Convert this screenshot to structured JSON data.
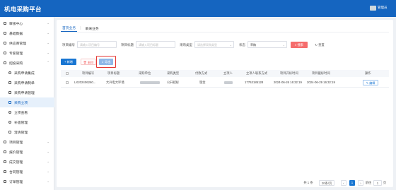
{
  "header": {
    "title": "机电采购平台",
    "user": "管理员"
  },
  "sidebar": {
    "items": [
      {
        "label": "审核中心"
      },
      {
        "label": "基础数据"
      },
      {
        "label": "供应商管理"
      },
      {
        "label": "专家管理"
      },
      {
        "label": "招投采购"
      },
      {
        "label": "采购申请集成"
      },
      {
        "label": "采购申请制单"
      },
      {
        "label": "采购申请管理"
      },
      {
        "label": "采购立项"
      },
      {
        "label": "立项查看"
      },
      {
        "label": "补遗管理"
      },
      {
        "label": "澄清管理"
      },
      {
        "label": "项目管理"
      },
      {
        "label": "报价管理"
      },
      {
        "label": "成交管理"
      },
      {
        "label": "合同管理"
      },
      {
        "label": "订单管理"
      }
    ]
  },
  "tabs": [
    {
      "label": "首页业务"
    },
    {
      "label": "单采业务"
    }
  ],
  "filters": {
    "project_no": {
      "label": "项目编号",
      "placeholder": "请输入项目编号"
    },
    "project_title": {
      "label": "项目标题",
      "placeholder": "请输入项目标题"
    },
    "purchase_type": {
      "label": "采购类型",
      "placeholder": "请选择采购类型"
    },
    "status": {
      "label": "状态",
      "value": "草稿"
    },
    "search_label": "搜索",
    "reset_label": "重置"
  },
  "toolbar": {
    "add_label": "新增",
    "delete_label": "删除",
    "export_label": "导出"
  },
  "table": {
    "columns": [
      "项目编号",
      "项目标题",
      "采购单位",
      "采购类型",
      "付款方式",
      "立项人",
      "立项人联系方式",
      "项目开标时间",
      "项目截标时间",
      "操作"
    ],
    "rows": [
      {
        "project_no": "LX202406260...",
        "title": "大兴电大环境",
        "purchase_type": "公开招标",
        "payment": "现金",
        "contact": "17763185128",
        "open_time": "2024-06-26 16:32:19",
        "close_time": "2024-06-29 16:32:19",
        "action": "编辑"
      }
    ]
  },
  "pagination": {
    "total": "共 1 条",
    "page_size": "20条/页",
    "current": "1",
    "goto_label": "前往",
    "goto_value": "1",
    "page_unit": "页"
  },
  "colors": {
    "primary": "#1565c0",
    "danger": "#f56c6c",
    "highlight": "#e53935"
  }
}
